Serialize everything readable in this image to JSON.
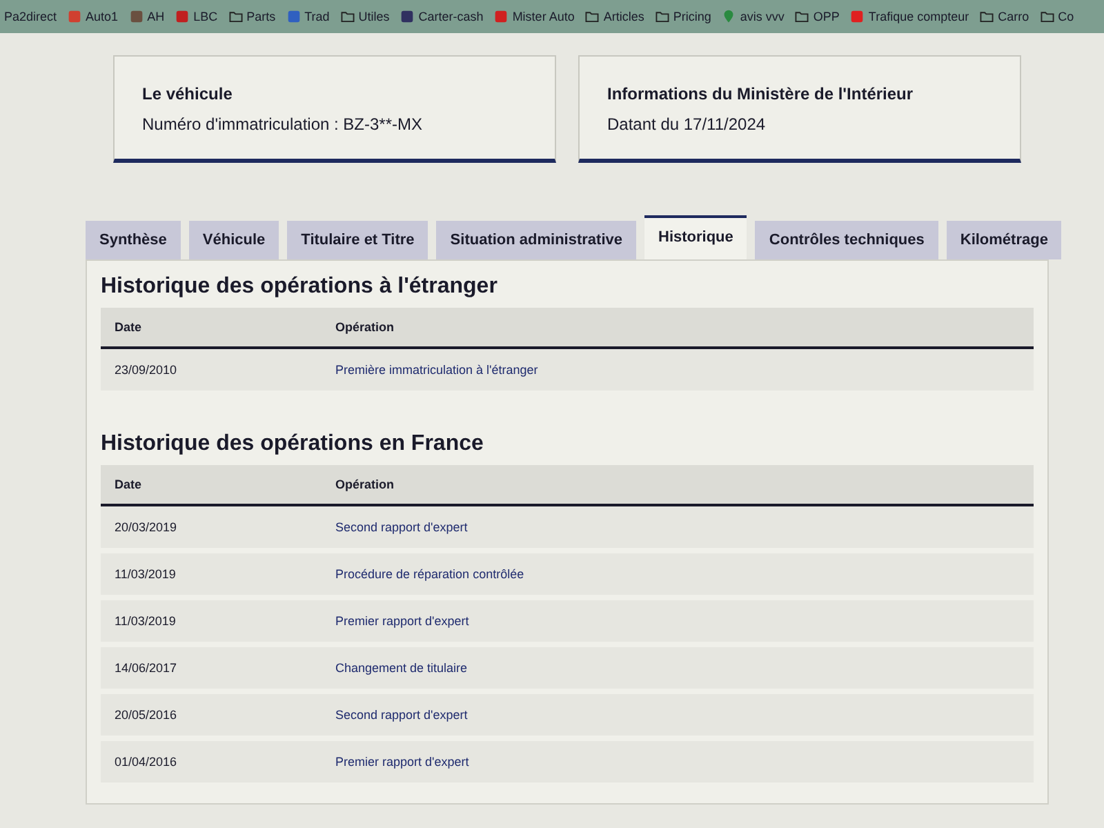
{
  "bookmarks": [
    {
      "label": "Pa2direct",
      "kind": "none"
    },
    {
      "label": "Auto1",
      "kind": "site",
      "color": "#d04030"
    },
    {
      "label": "AH",
      "kind": "site",
      "color": "#6a5040"
    },
    {
      "label": "LBC",
      "kind": "site",
      "color": "#c02020"
    },
    {
      "label": "Parts",
      "kind": "folder",
      "color": "#222222"
    },
    {
      "label": "Trad",
      "kind": "site",
      "color": "#3060c0"
    },
    {
      "label": "Utiles",
      "kind": "folder",
      "color": "#222222"
    },
    {
      "label": "Carter-cash",
      "kind": "site",
      "color": "#303060"
    },
    {
      "label": "Mister Auto",
      "kind": "site",
      "color": "#d02020"
    },
    {
      "label": "Articles",
      "kind": "folder",
      "color": "#222222"
    },
    {
      "label": "Pricing",
      "kind": "folder",
      "color": "#222222"
    },
    {
      "label": "avis vvv",
      "kind": "pin",
      "color": "#2a8a40"
    },
    {
      "label": "OPP",
      "kind": "folder",
      "color": "#222222"
    },
    {
      "label": "Trafique compteur",
      "kind": "site",
      "color": "#e02020"
    },
    {
      "label": "Carro",
      "kind": "folder",
      "color": "#222222"
    },
    {
      "label": "Co",
      "kind": "folder",
      "color": "#222222"
    }
  ],
  "cards": [
    {
      "title": "Le véhicule",
      "text": "Numéro d'immatriculation : BZ-3**-MX"
    },
    {
      "title": "Informations du Ministère de l'Intérieur",
      "text": "Datant du 17/11/2024"
    }
  ],
  "tabs": [
    {
      "label": "Synthèse",
      "selected": false
    },
    {
      "label": "Véhicule",
      "selected": false
    },
    {
      "label": "Titulaire et Titre",
      "selected": false
    },
    {
      "label": "Situation administrative",
      "selected": false
    },
    {
      "label": "Historique",
      "selected": true
    },
    {
      "label": "Contrôles techniques",
      "selected": false
    },
    {
      "label": "Kilométrage",
      "selected": false
    }
  ],
  "sections": [
    {
      "title": "Historique des opérations à l'étranger",
      "columns": [
        "Date",
        "Opération"
      ],
      "rows": [
        {
          "date": "23/09/2010",
          "operation": "Première immatriculation à l'étranger"
        }
      ]
    },
    {
      "title": "Historique des opérations en France",
      "columns": [
        "Date",
        "Opération"
      ],
      "rows": [
        {
          "date": "20/03/2019",
          "operation": "Second rapport d'expert"
        },
        {
          "date": "11/03/2019",
          "operation": "Procédure de réparation contrôlée"
        },
        {
          "date": "11/03/2019",
          "operation": "Premier rapport d'expert"
        },
        {
          "date": "14/06/2017",
          "operation": "Changement de titulaire"
        },
        {
          "date": "20/05/2016",
          "operation": "Second rapport d'expert"
        },
        {
          "date": "01/04/2016",
          "operation": "Premier rapport d'expert"
        }
      ]
    }
  ]
}
